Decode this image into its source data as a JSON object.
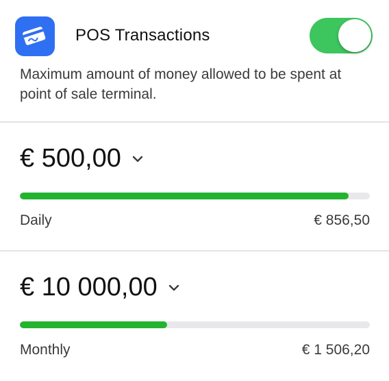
{
  "header": {
    "title": "POS Transactions",
    "toggle_on": true,
    "description": "Maximum amount of money allowed to be spent at point of sale terminal.",
    "icon": "credit-card-icon",
    "accent_color": "#2f6ff2",
    "toggle_color": "#3dc55e"
  },
  "limits": [
    {
      "amount": "€ 500,00",
      "period": "Daily",
      "spent": "€ 856,50",
      "progress_fraction": 0.94
    },
    {
      "amount": "€ 10 000,00",
      "period": "Monthly",
      "spent": "€ 1 506,20",
      "progress_fraction": 0.42
    }
  ],
  "colors": {
    "progress_fill": "#24b32e",
    "progress_track": "#e8e8ea"
  }
}
